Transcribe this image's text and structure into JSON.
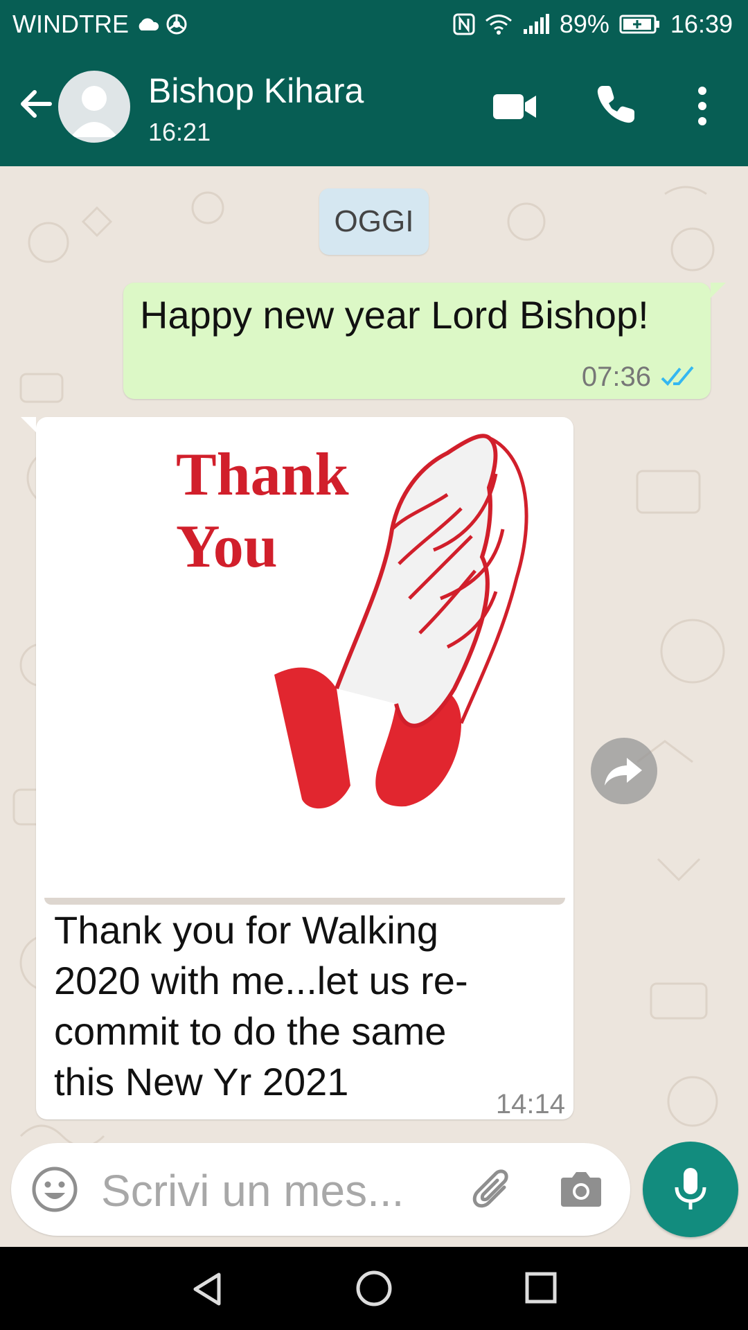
{
  "status_bar": {
    "carrier": "WINDTRE",
    "battery": "89%",
    "time": "16:39",
    "icons": [
      "cloud-icon",
      "chrome-icon",
      "nfc-icon",
      "wifi-icon",
      "signal-icon",
      "battery-icon"
    ]
  },
  "header": {
    "contact_name": "Bishop Kihara",
    "subtitle": "16:21"
  },
  "chat": {
    "date_label": "OGGI",
    "messages": [
      {
        "direction": "outgoing",
        "text": "Happy new year Lord Bishop!",
        "time": "07:36",
        "status": "read"
      },
      {
        "direction": "incoming",
        "image_text_line1": "Thank",
        "image_text_line2": "You",
        "caption": "Thank you for Walking\n2020 with me...let us re-\ncommit to do the same\nthis New Yr 2021",
        "time": "14:14"
      }
    ]
  },
  "input": {
    "placeholder": "Scrivi un mes..."
  },
  "colors": {
    "header": "#075e54",
    "outgoing_bubble": "#dcf8c6",
    "incoming_bubble": "#ffffff",
    "chat_background": "#ece5dd",
    "mic_button": "#128c7e",
    "read_ticks": "#34b7f1",
    "image_text": "#d11f2b"
  }
}
